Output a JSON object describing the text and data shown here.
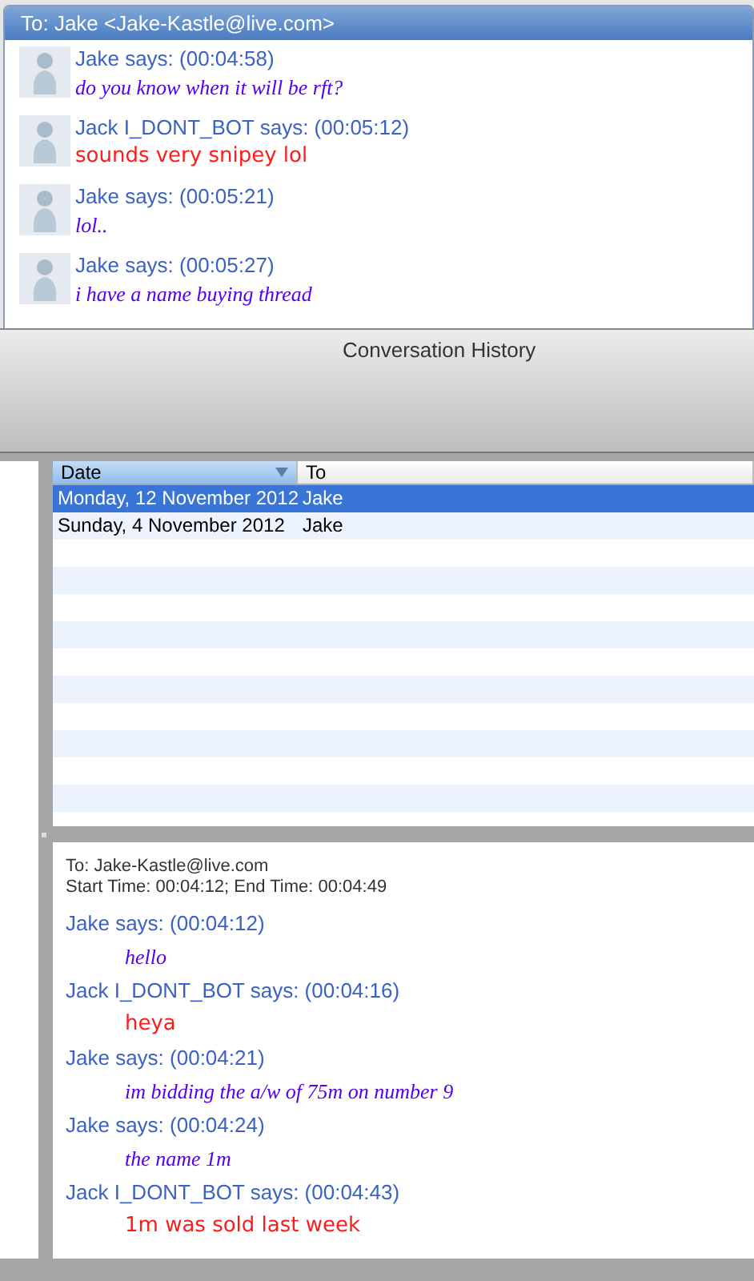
{
  "chat_window": {
    "title": "To: Jake <Jake-Kastle@live.com>",
    "messages": [
      {
        "sender": "Jake says: (00:04:58)",
        "text": "do you know when it will be rft?",
        "kind": "contact"
      },
      {
        "sender": "Jack I_DONT_BOT says: (00:05:12)",
        "text": "sounds very snipey lol",
        "kind": "self"
      },
      {
        "sender": "Jake says: (00:05:21)",
        "text": "lol..",
        "kind": "contact"
      },
      {
        "sender": "Jake says: (00:05:27)",
        "text": "i have a name buying thread",
        "kind": "contact"
      }
    ]
  },
  "history_window": {
    "title": "Conversation History",
    "table": {
      "columns": [
        {
          "label": "Date",
          "sorted": true
        },
        {
          "label": "To",
          "sorted": false
        }
      ],
      "rows": [
        {
          "date": "Monday, 12 November 2012",
          "to": "Jake",
          "selected": true
        },
        {
          "date": "Sunday, 4 November 2012",
          "to": "Jake",
          "selected": false
        }
      ]
    },
    "transcript": {
      "to": "To: Jake-Kastle@live.com",
      "times": "Start Time: 00:04:12; End Time: 00:04:49",
      "messages": [
        {
          "sender": "Jake says: (00:04:12)",
          "text": "hello",
          "kind": "contact"
        },
        {
          "sender": "Jack I_DONT_BOT says: (00:04:16)",
          "text": "heya",
          "kind": "self"
        },
        {
          "sender": "Jake says: (00:04:21)",
          "text": "im bidding the a/w of 75m on number 9",
          "kind": "contact"
        },
        {
          "sender": "Jake says: (00:04:24)",
          "text": "the name 1m",
          "kind": "contact"
        },
        {
          "sender": "Jack I_DONT_BOT says: (00:04:43)",
          "text": "1m was sold last week",
          "kind": "self"
        }
      ]
    }
  }
}
